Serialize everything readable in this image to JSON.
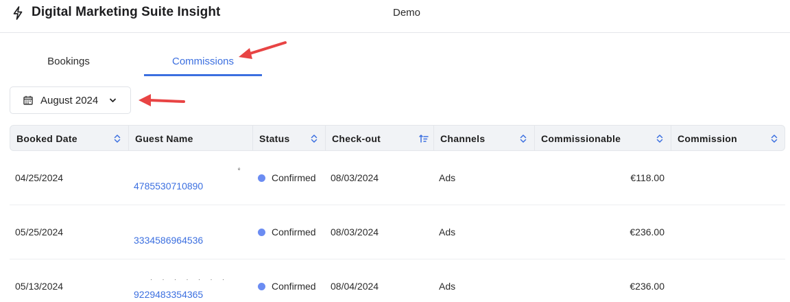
{
  "app": {
    "title": "Digital Marketing Suite Insight",
    "environment": "Demo",
    "logo_icon": "lightning-bolt-icon"
  },
  "tabs": [
    {
      "label": "Bookings",
      "active": false
    },
    {
      "label": "Commissions",
      "active": true
    }
  ],
  "date_filter": {
    "value": "August 2024",
    "icon": "calendar-icon",
    "dropdown_icon": "chevron-down-icon"
  },
  "colors": {
    "accent": "#3b6fe0",
    "status_confirmed": "#6b8cf2",
    "annotation_arrow": "#e84444"
  },
  "table": {
    "columns": [
      {
        "label": "Booked Date",
        "sort_icon": "sort-both-icon"
      },
      {
        "label": "Guest Name",
        "sort_icon": ""
      },
      {
        "label": "Status",
        "sort_icon": "sort-both-icon"
      },
      {
        "label": "Check-out",
        "sort_icon": "sort-ascending-icon"
      },
      {
        "label": "Channels",
        "sort_icon": "sort-both-icon"
      },
      {
        "label": "Commissionable",
        "sort_icon": "sort-both-icon"
      },
      {
        "label": "Commission",
        "sort_icon": "sort-both-icon"
      }
    ],
    "rows": [
      {
        "booked_date": "04/25/2024",
        "guest_id": "4785530710890",
        "status": "Confirmed",
        "check_out": "08/03/2024",
        "channel": "Ads",
        "commissionable": "€118.00",
        "commission": ""
      },
      {
        "booked_date": "05/25/2024",
        "guest_id": "3334586964536",
        "status": "Confirmed",
        "check_out": "08/03/2024",
        "channel": "Ads",
        "commissionable": "€236.00",
        "commission": ""
      },
      {
        "booked_date": "05/13/2024",
        "guest_id": "9229483354365",
        "status": "Confirmed",
        "check_out": "08/04/2024",
        "channel": "Ads",
        "commissionable": "€236.00",
        "commission": ""
      }
    ]
  }
}
